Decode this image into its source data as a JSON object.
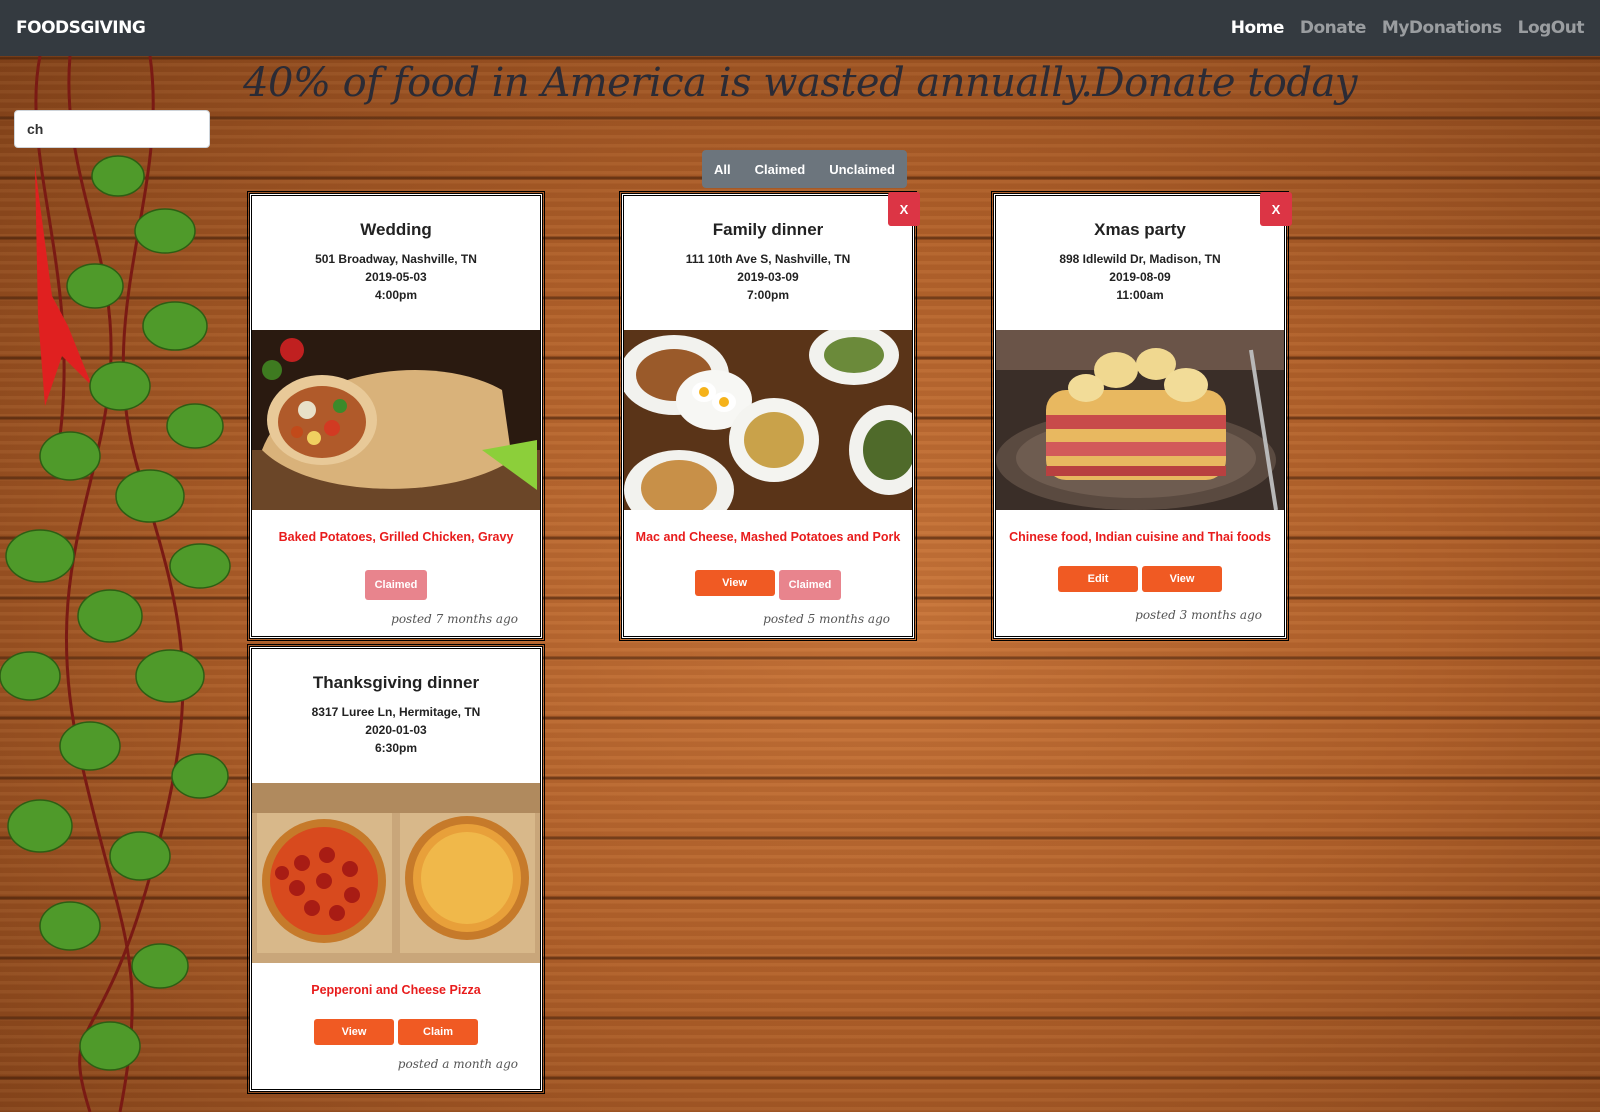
{
  "navbar": {
    "brand": "FOODSGIVING",
    "links": [
      "Home",
      "Donate",
      "MyDonations",
      "LogOut"
    ]
  },
  "headline": "40% of food in America is wasted annually.Donate today",
  "search": {
    "value": "ch"
  },
  "filters": [
    "All",
    "Claimed",
    "Unclaimed"
  ],
  "cards": [
    {
      "title": "Wedding",
      "address": "501 Broadway, Nashville, TN",
      "date": "2019-05-03",
      "time": "4:00pm",
      "food": "Baked Potatoes, Grilled Chicken, Gravy",
      "buttons": [
        "Claimed"
      ],
      "posted": "posted 7 months ago",
      "delete_label": ""
    },
    {
      "title": "Family dinner",
      "address": "111 10th Ave S, Nashville, TN",
      "date": "2019-03-09",
      "time": "7:00pm",
      "food": "Mac and Cheese, Mashed Potatoes and Pork",
      "buttons": [
        "View",
        "Claimed"
      ],
      "posted": "posted 5 months ago",
      "delete_label": "X"
    },
    {
      "title": "Xmas party",
      "address": "898 Idlewild Dr, Madison, TN",
      "date": "2019-08-09",
      "time": "11:00am",
      "food": "Chinese food, Indian cuisine and Thai foods",
      "buttons": [
        "Edit",
        "View"
      ],
      "posted": "posted 3 months ago",
      "delete_label": "X"
    },
    {
      "title": "Thanksgiving dinner",
      "address": "8317 Luree Ln, Hermitage, TN",
      "date": "2020-01-03",
      "time": "6:30pm",
      "food": "Pepperoni and Cheese Pizza",
      "buttons": [
        "View",
        "Claim"
      ],
      "posted": "posted a month ago",
      "delete_label": ""
    }
  ]
}
